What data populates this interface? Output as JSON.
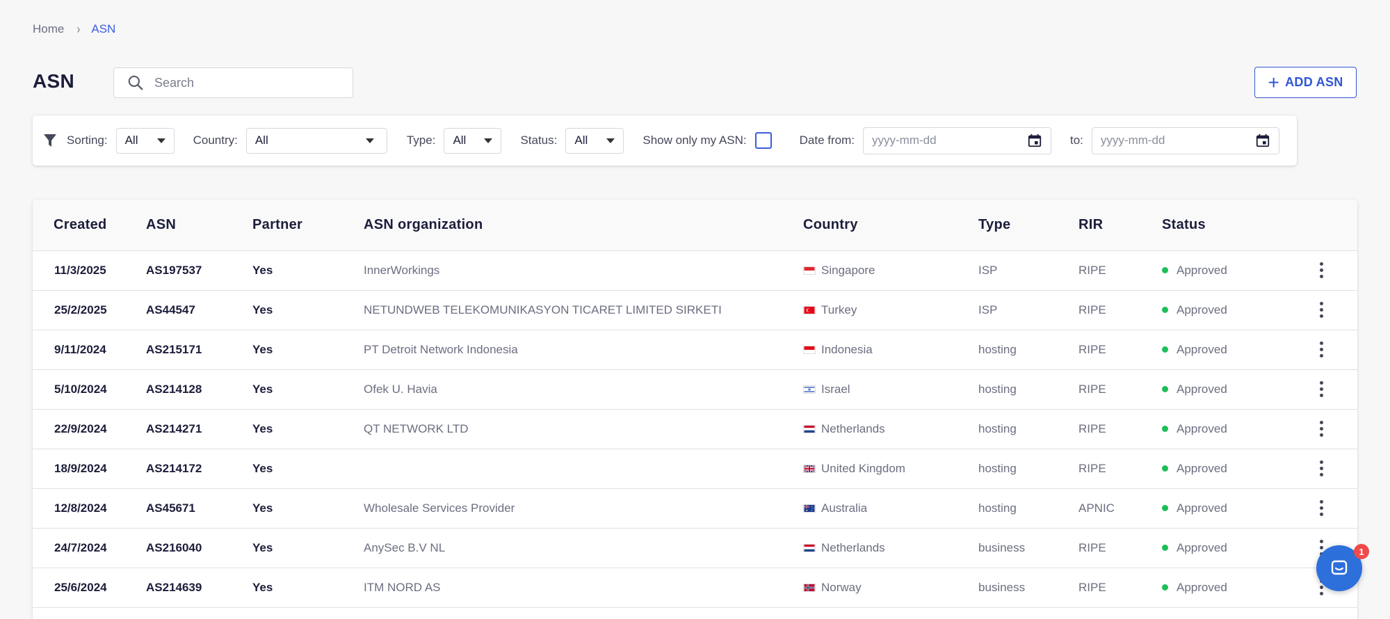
{
  "breadcrumb": {
    "home": "Home",
    "current": "ASN"
  },
  "page": {
    "title": "ASN"
  },
  "search": {
    "placeholder": "Search"
  },
  "actions": {
    "add_label": "ADD ASN"
  },
  "filters": {
    "sorting_label": "Sorting:",
    "sorting_value": "All",
    "country_label": "Country:",
    "country_value": "All",
    "type_label": "Type:",
    "type_value": "All",
    "status_label": "Status:",
    "status_value": "All",
    "only_mine_label": "Show only my ASN:",
    "date_from_label": "Date from:",
    "date_from_placeholder": "yyyy-mm-dd",
    "date_to_label": "to:",
    "date_to_placeholder": "yyyy-mm-dd"
  },
  "table": {
    "headers": [
      "Created",
      "ASN",
      "Partner",
      "ASN organization",
      "Country",
      "Type",
      "RIR",
      "Status"
    ],
    "rows": [
      {
        "created": "11/3/2025",
        "asn": "AS197537",
        "partner": "Yes",
        "org": "InnerWorkings",
        "country": "Singapore",
        "flag": "sg",
        "type": "ISP",
        "rir": "RIPE",
        "status": "Approved"
      },
      {
        "created": "25/2/2025",
        "asn": "AS44547",
        "partner": "Yes",
        "org": "NETUNDWEB TELEKOMUNIKASYON TICARET LIMITED SIRKETI",
        "country": "Turkey",
        "flag": "tr",
        "type": "ISP",
        "rir": "RIPE",
        "status": "Approved"
      },
      {
        "created": "9/11/2024",
        "asn": "AS215171",
        "partner": "Yes",
        "org": "PT Detroit Network Indonesia",
        "country": "Indonesia",
        "flag": "id",
        "type": "hosting",
        "rir": "RIPE",
        "status": "Approved"
      },
      {
        "created": "5/10/2024",
        "asn": "AS214128",
        "partner": "Yes",
        "org": "Ofek U. Havia",
        "country": "Israel",
        "flag": "il",
        "type": "hosting",
        "rir": "RIPE",
        "status": "Approved"
      },
      {
        "created": "22/9/2024",
        "asn": "AS214271",
        "partner": "Yes",
        "org": "QT NETWORK LTD",
        "country": "Netherlands",
        "flag": "nl",
        "type": "hosting",
        "rir": "RIPE",
        "status": "Approved"
      },
      {
        "created": "18/9/2024",
        "asn": "AS214172",
        "partner": "Yes",
        "org": "",
        "country": "United Kingdom",
        "flag": "gb",
        "type": "hosting",
        "rir": "RIPE",
        "status": "Approved"
      },
      {
        "created": "12/8/2024",
        "asn": "AS45671",
        "partner": "Yes",
        "org": "Wholesale Services Provider",
        "country": "Australia",
        "flag": "au",
        "type": "hosting",
        "rir": "APNIC",
        "status": "Approved"
      },
      {
        "created": "24/7/2024",
        "asn": "AS216040",
        "partner": "Yes",
        "org": "AnySec B.V NL",
        "country": "Netherlands",
        "flag": "nl",
        "type": "business",
        "rir": "RIPE",
        "status": "Approved"
      },
      {
        "created": "25/6/2024",
        "asn": "AS214639",
        "partner": "Yes",
        "org": "ITM NORD AS",
        "country": "Norway",
        "flag": "no",
        "type": "business",
        "rir": "RIPE",
        "status": "Approved"
      }
    ]
  },
  "chat": {
    "badge": "1"
  },
  "colors": {
    "accent": "#2f55d4",
    "status_ok": "#1ebd5a",
    "chat": "#2d6fdb",
    "badge": "#f04a4a"
  }
}
